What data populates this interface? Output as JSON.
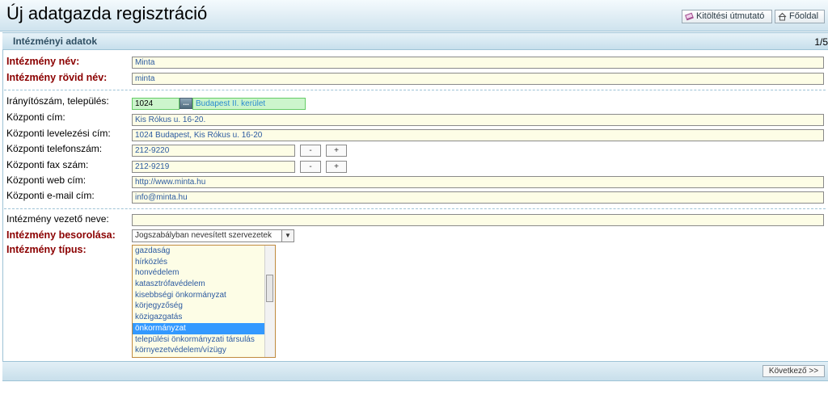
{
  "header": {
    "title": "Új adatgazda regisztráció",
    "help_label": "Kitöltési útmutató",
    "home_label": "Főoldal"
  },
  "panel": {
    "title": "Intézményi adatok",
    "page": "1/5"
  },
  "fields": {
    "name": {
      "label": "Intézmény név:",
      "value": "Minta"
    },
    "short_name": {
      "label": "Intézmény rövid név:",
      "value": "minta"
    },
    "zip_city": {
      "label": "Irányítószám, település:",
      "zip": "1024",
      "city": "Budapest II. kerület",
      "lookup": "..."
    },
    "address": {
      "label": "Központi cím:",
      "value": "Kis Rókus u. 16-20."
    },
    "mail_address": {
      "label": "Központi levelezési cím:",
      "value": "1024 Budapest, Kis Rókus u. 16-20"
    },
    "phone": {
      "label": "Központi telefonszám:",
      "value": "212-9220"
    },
    "fax": {
      "label": "Központi fax szám:",
      "value": "212-9219"
    },
    "web": {
      "label": "Központi web cím:",
      "value": "http://www.minta.hu"
    },
    "email": {
      "label": "Központi e-mail cím:",
      "value": "info@minta.hu"
    },
    "leader": {
      "label": "Intézmény vezető neve:",
      "value": ""
    },
    "classification": {
      "label": "Intézmény besorolása:",
      "value": "Jogszabályban nevesített szervezetek"
    },
    "type": {
      "label": "Intézmény típus:"
    }
  },
  "buttons": {
    "minus": "-",
    "plus": "+",
    "next": "Következő >>"
  },
  "type_options": [
    "gazdaság",
    "hírközlés",
    "honvédelem",
    "katasztrófavédelem",
    "kisebbségi önkormányzat",
    "körjegyzőség",
    "közigazgatás",
    "önkormányzat",
    "települési önkormányzati társulás",
    "környezetvédelem/vízügy"
  ],
  "selected_type": "önkormányzat"
}
